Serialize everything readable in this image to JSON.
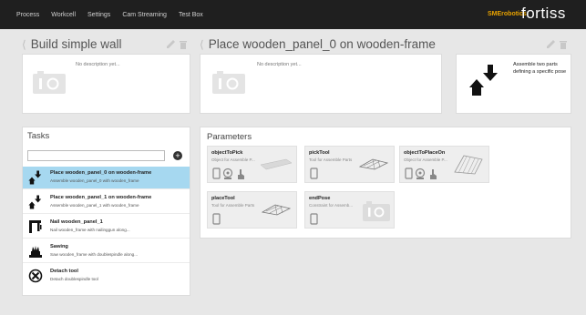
{
  "nav": [
    "Process",
    "Workcell",
    "Settings",
    "Cam Streaming",
    "Test Box"
  ],
  "brand": {
    "sme": "SMErobotics",
    "fortiss": "fortiss"
  },
  "process": {
    "title": "Build simple wall",
    "description": "No description yet..."
  },
  "task": {
    "title": "Place wooden_panel_0 on wooden-frame",
    "description": "No description yet...",
    "pose_text": "Assemble two parts defining a specific pose"
  },
  "tasks": {
    "title": "Tasks",
    "search_value": "",
    "items": [
      {
        "name": "Place wooden_panel_0 on wooden-frame",
        "desc": "Assemble wooden_panel_0 with wooden_frame",
        "icon": "assemble-icon",
        "selected": true
      },
      {
        "name": "Place wooden_panel_1 on wooden-frame",
        "desc": "Assemble wooden_panel_1 with wooden_frame",
        "icon": "assemble-icon",
        "selected": false
      },
      {
        "name": "Nail wooden_panel_1",
        "desc": "Nail wooden_frame with nailinggun along...",
        "icon": "nailgun-icon",
        "selected": false
      },
      {
        "name": "Sawing",
        "desc": "Saw wooden_frame with doublespindle along...",
        "icon": "saw-icon",
        "selected": false
      },
      {
        "name": "Detach tool",
        "desc": "Detach doublespindle tool",
        "icon": "detach-icon",
        "selected": false
      }
    ]
  },
  "parameters": {
    "title": "Parameters",
    "items": [
      {
        "name": "objectToPick",
        "desc": "Object for Assemble P..."
      },
      {
        "name": "pickTool",
        "desc": "Tool for Assemble Parts"
      },
      {
        "name": "objectToPlaceOn",
        "desc": "Object for Assemble P..."
      },
      {
        "name": "placeTool",
        "desc": "Tool for Assemble Parts"
      },
      {
        "name": "endPose",
        "desc": "Constraint for Assemb..."
      }
    ]
  },
  "colors": {
    "selected_row": "#a6d8f0",
    "topbar": "#1f1f1f",
    "sme_brand": "#e8a200"
  }
}
